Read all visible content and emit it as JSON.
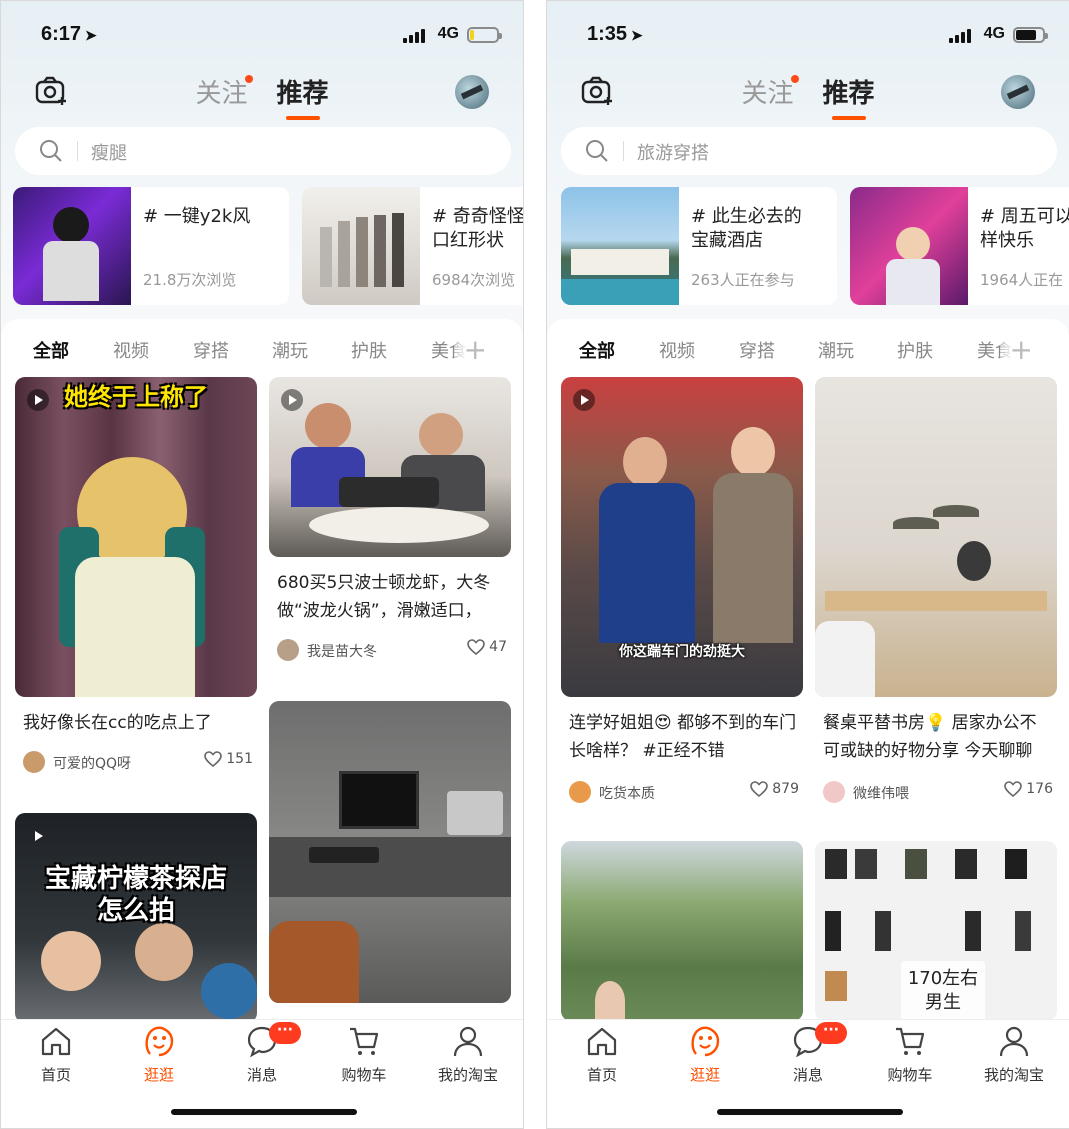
{
  "phones": [
    {
      "status": {
        "time": "6:17",
        "network": "4G",
        "battery_color": "#f2d21b",
        "battery_level": 0.15
      },
      "tabs": {
        "follow": "关注",
        "recommend": "推荐"
      },
      "search": {
        "placeholder": "瘦腿"
      },
      "topics": [
        {
          "title": "# 一键y2k风",
          "sub": "21.8万次浏览"
        },
        {
          "title": "# 奇奇怪怪\n口红形状",
          "sub": "6984次浏览"
        }
      ],
      "categories": [
        "全部",
        "视频",
        "穿搭",
        "潮玩",
        "护肤",
        "美食"
      ],
      "posts": [
        {
          "overlay": "她终于上称了",
          "title": "我好像长在cc的吃点上了",
          "author": "可爱的QQ呀",
          "likes": "151"
        },
        {
          "title": "680买5只波士顿龙虾，大冬做“波龙火锅”，滑嫩适口，",
          "author": "我是苗大冬",
          "likes": "47"
        },
        {
          "overlay": "宝藏柠檬茶探店\n怎么拍"
        },
        {}
      ],
      "tabbar": [
        "首页",
        "逛逛",
        "消息",
        "购物车",
        "我的淘宝"
      ],
      "badge": "···"
    },
    {
      "status": {
        "time": "1:35",
        "network": "4G",
        "battery_color": "#111111",
        "battery_level": 0.75
      },
      "tabs": {
        "follow": "关注",
        "recommend": "推荐"
      },
      "search": {
        "placeholder": "旅游穿搭"
      },
      "topics": [
        {
          "title": "# 此生必去的\n宝藏酒店",
          "sub": "263人正在参与"
        },
        {
          "title": "# 周五可以\n样快乐",
          "sub": "1964人正在"
        }
      ],
      "categories": [
        "全部",
        "视频",
        "穿搭",
        "潮玩",
        "护肤",
        "美食"
      ],
      "posts": [
        {
          "caption": "你这踹车门的劲挺大",
          "title": "连学好姐姐😍 都够不到的车门长啥样？ #正经不错",
          "author": "吃货本质",
          "likes": "879"
        },
        {
          "title": "餐桌平替书房💡 居家办公不可或缺的好物分享 今天聊聊",
          "author": "微维伟喂",
          "likes": "176"
        },
        {},
        {
          "stamp": "170左右\n男生"
        }
      ],
      "tabbar": [
        "首页",
        "逛逛",
        "消息",
        "购物车",
        "我的淘宝"
      ],
      "badge": "···"
    }
  ],
  "colors": {
    "accent": "#ff5000",
    "badge": "#ff3b1f"
  }
}
